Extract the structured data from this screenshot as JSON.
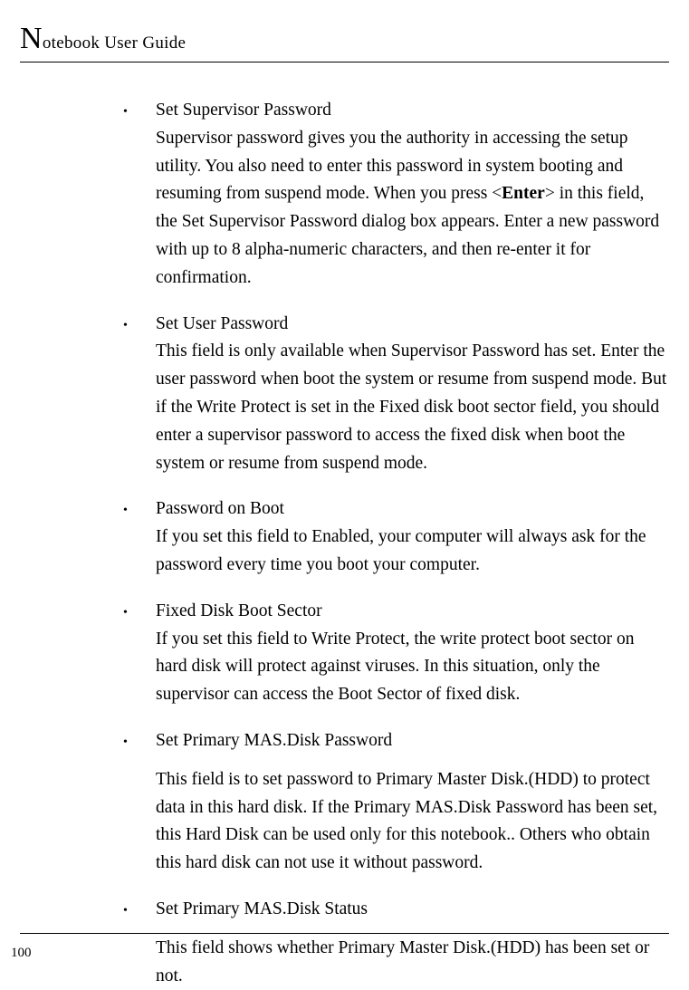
{
  "header": {
    "initial": "N",
    "rest": "otebook User Guide"
  },
  "items": [
    {
      "title": "Set Supervisor Password",
      "pre": "Supervisor password gives you the authority in accessing the setup utility. You also need to enter this password in system booting and resuming from suspend mode. When you press <",
      "bold": "Enter",
      "post": "> in this field, the Set Supervisor Password dialog box appears. Enter a new password with up to 8 alpha-numeric characters, and then re-enter it for confirmation."
    },
    {
      "title": "Set User Password",
      "text": "This field is only available when Supervisor Password has set. Enter the user password when boot the system or resume from suspend mode. But if the Write Protect is set in the Fixed disk boot sector field, you should enter a supervisor password to access the fixed disk when boot the system or resume from suspend mode."
    },
    {
      "title": "Password on Boot",
      "text": "If  you set this field to Enabled, your computer will always ask for the password every time you boot your computer."
    },
    {
      "title": "Fixed Disk Boot Sector",
      "text": "If you set this field to Write Protect, the write protect boot sector on hard disk will protect against viruses. In this situation, only the supervisor can access the Boot Sector of fixed disk."
    },
    {
      "title": "Set Primary MAS.Disk Password",
      "para": "This field is to set password to Primary Master Disk.(HDD) to protect data in this hard disk. If the Primary MAS.Disk Password has been set, this Hard Disk can be used only for this notebook.. Others who obtain this hard disk can not use it without password."
    },
    {
      "title": "Set Primary MAS.Disk Status",
      "para": "This field shows whether Primary Master Disk.(HDD) has been set or not."
    }
  ],
  "pageNumber": "100"
}
